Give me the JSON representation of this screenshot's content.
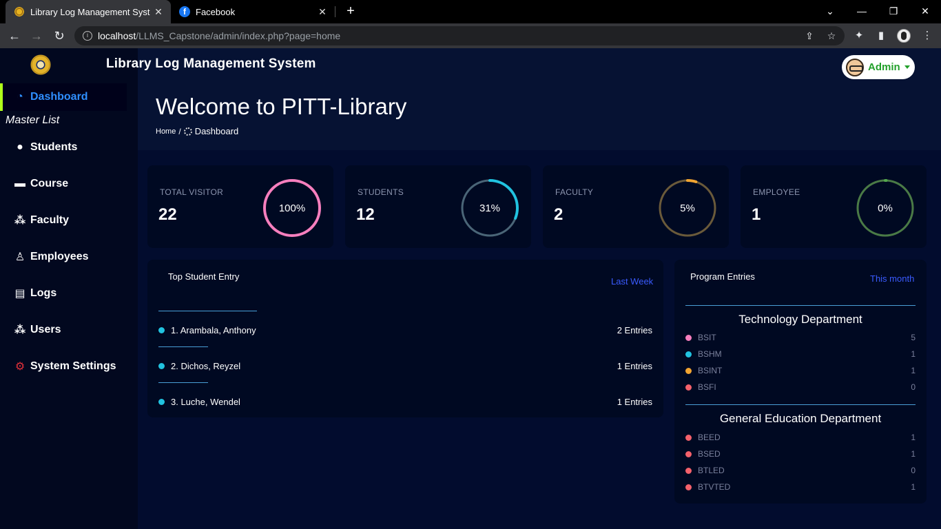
{
  "browser": {
    "tabs": [
      {
        "title": "Library Log Management System",
        "close": "✕"
      },
      {
        "title": "Facebook",
        "close": "✕",
        "icon": "f"
      }
    ],
    "new_tab": "+",
    "window": {
      "minimize": "—",
      "maximize": "❐",
      "close": "✕",
      "dropdown": "⌄"
    },
    "nav": {
      "back": "←",
      "forward": "→",
      "reload": "↻"
    },
    "address": {
      "host": "localhost",
      "path": "/LLMS_Capstone/admin/index.php?page=home"
    },
    "icons": {
      "share": "⇪",
      "bookmark": "☆",
      "extensions": "✦",
      "sidepanel": "▮"
    }
  },
  "header": {
    "brand": "Library Log Management System",
    "user": "Admin"
  },
  "sidebar": {
    "active": {
      "label": "Dashboard",
      "icon": "◔"
    },
    "section_header": "Master List",
    "items": [
      {
        "label": "Students",
        "icon": "●"
      },
      {
        "label": "Course",
        "icon": "▬"
      },
      {
        "label": "Faculty",
        "icon": "⁂"
      },
      {
        "label": "Employees",
        "icon": "♙"
      },
      {
        "label": "Logs",
        "icon": "▤"
      },
      {
        "label": "Users",
        "icon": "⁂"
      },
      {
        "label": "System Settings",
        "icon": "⚙"
      }
    ]
  },
  "main": {
    "title": "Welcome to PITT-Library",
    "breadcrumb": {
      "home": "Home",
      "sep": "/",
      "current": "Dashboard"
    }
  },
  "stats": [
    {
      "label": "TOTAL VISITOR",
      "value": "22",
      "percent_text": "100%",
      "percent": 100,
      "color": "#f77fbe",
      "track": "#f77fbe"
    },
    {
      "label": "STUDENTS",
      "value": "12",
      "percent_text": "31%",
      "percent": 31,
      "color": "#21c3e0",
      "track": "#4a6577"
    },
    {
      "label": "FACULTY",
      "value": "2",
      "percent_text": "5%",
      "percent": 5,
      "color": "#f2a531",
      "track": "#6a5a3a"
    },
    {
      "label": "EMPLOYEE",
      "value": "1",
      "percent_text": "0%",
      "percent": 0,
      "color": "#54a84e",
      "track": "#4a7a46"
    }
  ],
  "top_student": {
    "title": "Top Student Entry",
    "filter": "Last Week",
    "entries": [
      {
        "name": "1. Arambala, Anthony",
        "count": "2 Entries"
      },
      {
        "name": "2. Dichos, Reyzel",
        "count": "1 Entries"
      },
      {
        "name": "3. Luche, Wendel",
        "count": "1 Entries"
      }
    ],
    "dot_color": "#21c3e0"
  },
  "program_entries": {
    "title": "Program Entries",
    "filter": "This month",
    "departments": [
      {
        "name": "Technology Department",
        "programs": [
          {
            "name": "BSIT",
            "count": "5",
            "color": "#f77fbe"
          },
          {
            "name": "BSHM",
            "count": "1",
            "color": "#21c3e0"
          },
          {
            "name": "BSINT",
            "count": "1",
            "color": "#f2a531"
          },
          {
            "name": "BSFI",
            "count": "0",
            "color": "#f4616b"
          }
        ]
      },
      {
        "name": "General Education Department",
        "programs": [
          {
            "name": "BEED",
            "count": "1",
            "color": "#f4616b"
          },
          {
            "name": "BSED",
            "count": "1",
            "color": "#f4616b"
          },
          {
            "name": "BTLED",
            "count": "0",
            "color": "#f4616b"
          },
          {
            "name": "BTVTED",
            "count": "1",
            "color": "#f4616b"
          }
        ]
      }
    ]
  }
}
